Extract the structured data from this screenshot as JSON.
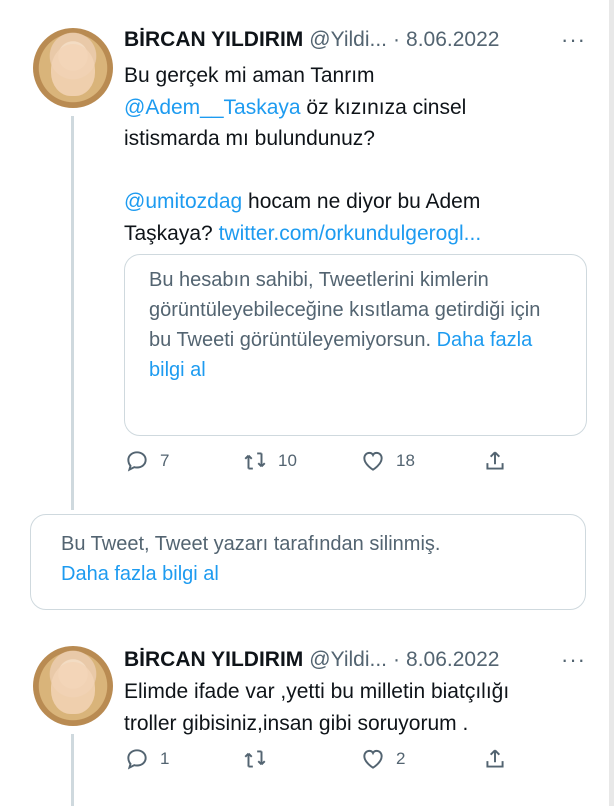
{
  "tweet1": {
    "name": "BİRCAN YILDIRIM",
    "handle": "@Yildi...",
    "separator": "·",
    "date": "8.06.2022",
    "more": "···",
    "text_line1": "Bu gerçek mi aman Tanrım",
    "mention1": "@Adem__Taskaya",
    "text_line2": " öz kızınıza cinsel",
    "text_line3": "istismarda mı bulundunuz?",
    "mention2": "@umitozdag",
    "text_line4": " hocam ne diyor bu Adem",
    "text_line5": "Taşkaya? ",
    "link": "twitter.com/orkundulgerogl...",
    "quote_text": "Bu hesabın sahibi, Tweetlerini kimlerin görüntüleyebileceğine kısıtlama getirdiği için bu Tweeti görüntüleyemiyorsun. ",
    "quote_link": "Daha fazla bilgi al",
    "replies": "7",
    "retweets": "10",
    "likes": "18"
  },
  "deleted_tweet": {
    "text": "Bu Tweet, Tweet yazarı tarafından silinmiş.",
    "link": "Daha fazla bilgi al"
  },
  "tweet2": {
    "name": "BİRCAN YILDIRIM",
    "handle": "@Yildi...",
    "separator": "·",
    "date": "8.06.2022",
    "more": "···",
    "text_line1": "Elimde ifade var ,yetti bu milletin biatçılığı",
    "text_line2": "troller gibisiniz,insan gibi soruyorum .",
    "replies": "1",
    "retweets": "",
    "likes": "2"
  },
  "icons": [
    "reply-icon",
    "retweet-icon",
    "like-icon",
    "share-icon",
    "more-icon"
  ],
  "colors": {
    "link": "#1d9bf0",
    "secondary": "#536471",
    "border": "#cfd9de"
  }
}
